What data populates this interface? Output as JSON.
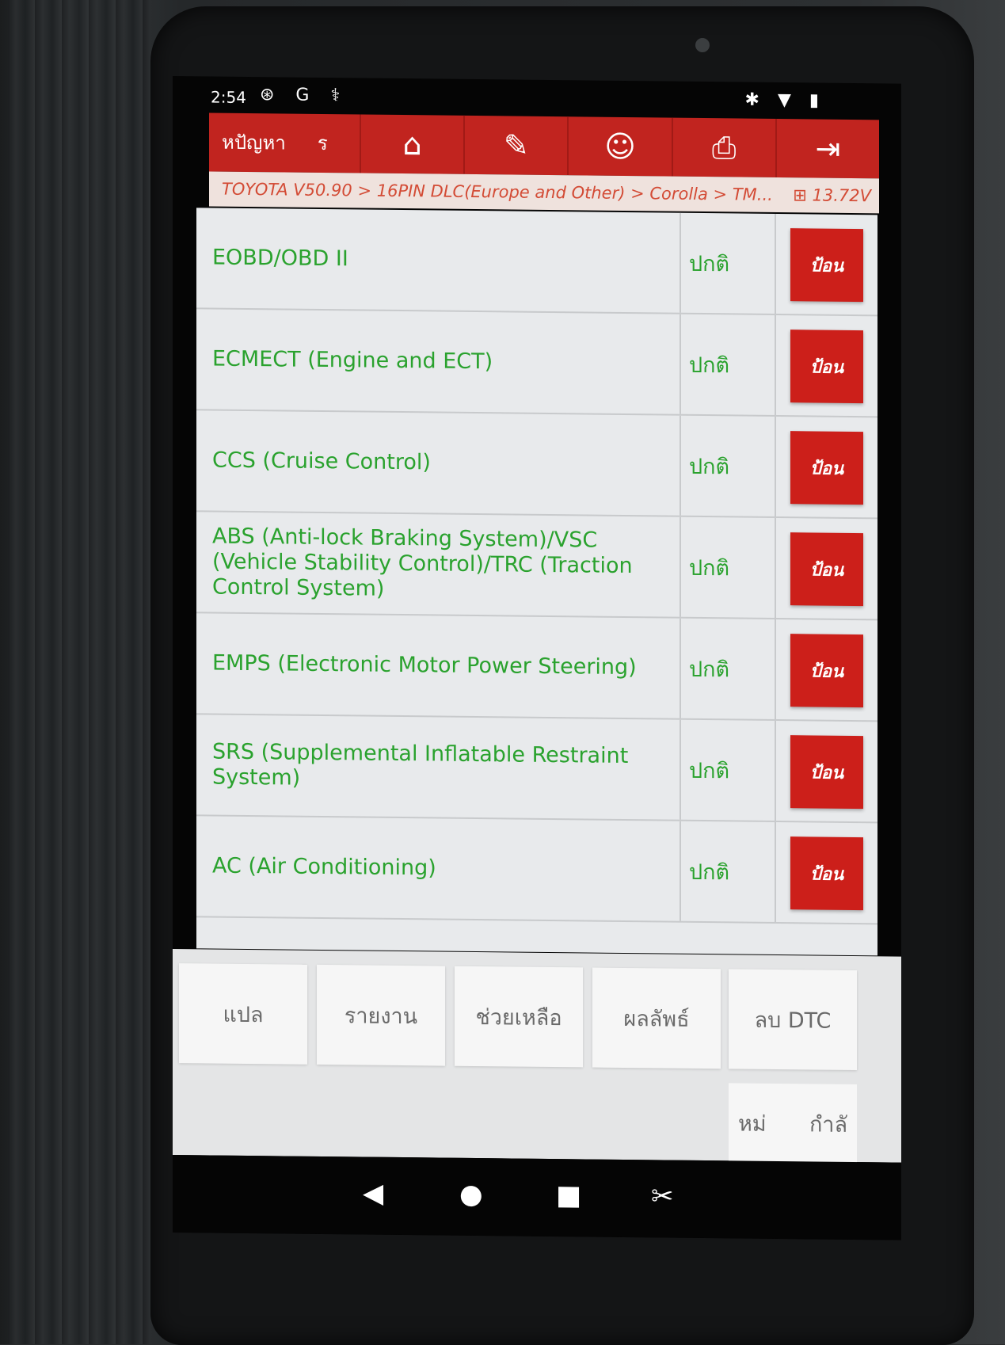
{
  "status_bar": {
    "time": "2:54",
    "left_icons": [
      "settings-badge-icon",
      "google-icon",
      "usb-icon"
    ],
    "left_glyphs": "⊛ G ⚕",
    "right_icons": [
      "bluetooth-icon",
      "wifi-icon",
      "battery-icon"
    ],
    "right_glyphs": "✱ ▼ ▮"
  },
  "toolbar": {
    "title": "หปัญหา",
    "title_suffix": "ร",
    "buttons": [
      {
        "icon": "home-icon",
        "glyph": "⌂"
      },
      {
        "icon": "edit-icon",
        "glyph": "✎"
      },
      {
        "icon": "support-icon",
        "glyph": "☺"
      },
      {
        "icon": "print-icon",
        "glyph": "⎙"
      },
      {
        "icon": "exit-icon",
        "glyph": "⇥"
      }
    ]
  },
  "breadcrumb": {
    "path": "TOYOTA V50.90 > 16PIN DLC(Europe and Other) > Corolla > TM...",
    "voltage": "13.72V",
    "voltage_icon": "battery-voltage-icon",
    "voltage_glyph": "⊞"
  },
  "systems": [
    {
      "name": "EOBD/OBD II",
      "status": "ปกติ",
      "action": "ป้อน"
    },
    {
      "name": "ECMECT (Engine and ECT)",
      "status": "ปกติ",
      "action": "ป้อน"
    },
    {
      "name": "CCS (Cruise Control)",
      "status": "ปกติ",
      "action": "ป้อน"
    },
    {
      "name": "ABS (Anti-lock Braking System)/VSC (Vehicle Stability Control)/TRC (Traction Control System)",
      "status": "ปกติ",
      "action": "ป้อน"
    },
    {
      "name": "EMPS (Electronic Motor Power Steering)",
      "status": "ปกติ",
      "action": "ป้อน"
    },
    {
      "name": "SRS (Supplemental Inflatable Restraint System)",
      "status": "ปกติ",
      "action": "ป้อน"
    },
    {
      "name": "AC (Air Conditioning)",
      "status": "ปกติ",
      "action": "ป้อน"
    }
  ],
  "function_buttons": {
    "translate": "แปล",
    "report": "รายงาน",
    "help": "ช่วยเหลือ",
    "result": "ผลลัพธ์",
    "clear_dtc": "ลบ DTC",
    "new_left": "หม่",
    "new_right": "กำลั"
  },
  "nav": {
    "back": "◀",
    "home": "●",
    "recent": "■",
    "screenshot": "✂"
  },
  "colors": {
    "toolbar": "#c1241f",
    "action_button": "#cc1f1a",
    "status_text": "#2aa22e",
    "breadcrumb_text": "#d34b35"
  }
}
